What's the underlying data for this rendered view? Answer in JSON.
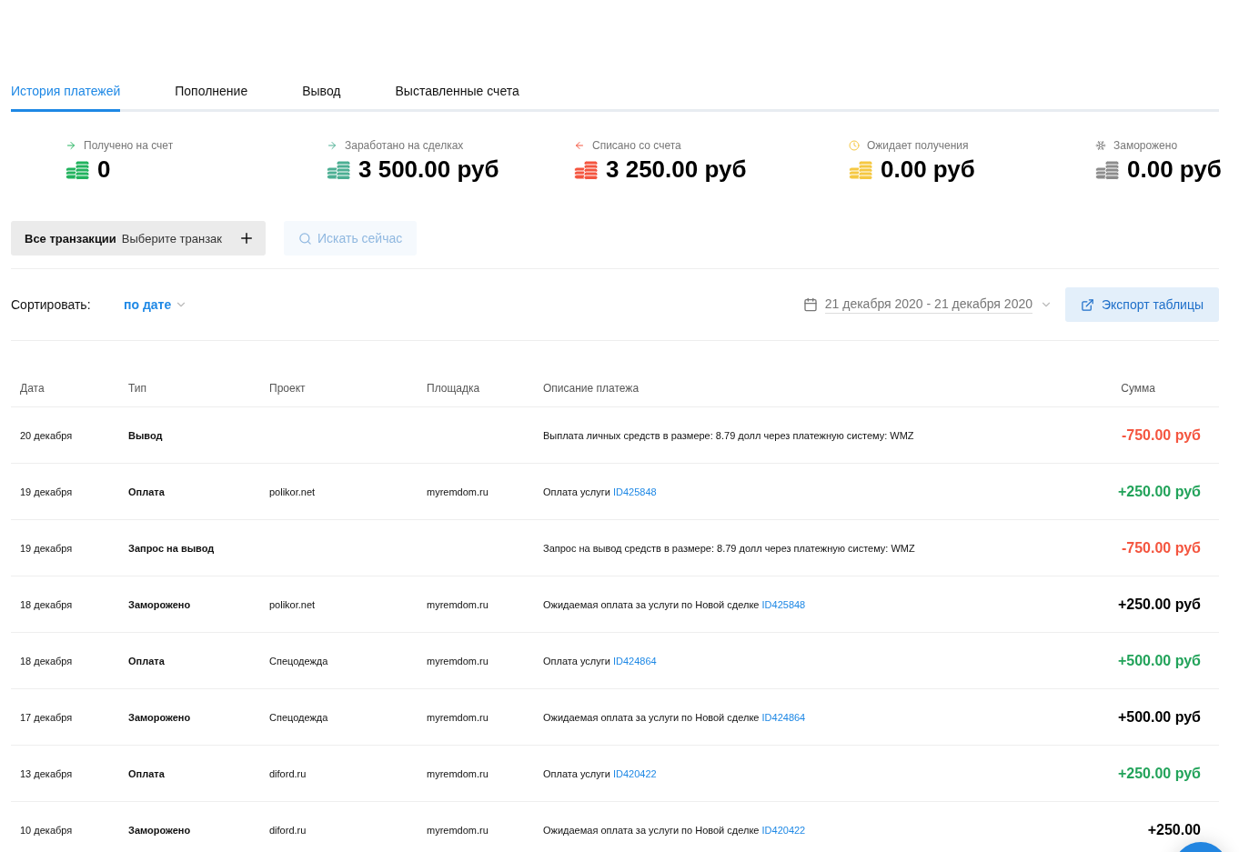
{
  "tabs": [
    {
      "label": "История платежей",
      "selected": true
    },
    {
      "label": "Пополнение",
      "selected": false
    },
    {
      "label": "Вывод",
      "selected": false
    },
    {
      "label": "Выставленные счета",
      "selected": false
    }
  ],
  "stats": [
    {
      "kind": "in",
      "label": "Получено на счет",
      "value": "0",
      "color": "#22b35e"
    },
    {
      "kind": "in",
      "label": "Заработано на сделках",
      "value": "3 500.00 руб",
      "color": "#4caf93"
    },
    {
      "kind": "out",
      "label": "Списано со счета",
      "value": "3 250.00 руб",
      "color": "#f4553f"
    },
    {
      "kind": "pending",
      "label": "Ожидает получения",
      "value": "0.00 руб",
      "color": "#f5c842"
    },
    {
      "kind": "frozen",
      "label": "Заморожено",
      "value": "0.00 руб",
      "color": "#8c8c8c"
    }
  ],
  "filter": {
    "label": "Все транзакции",
    "placeholder": "Выберите транзак"
  },
  "search": {
    "label": "Искать сейчас"
  },
  "sort": {
    "label": "Сортировать:",
    "value": "по дате",
    "date_range": "21 декабря 2020 - 21 декабря 2020",
    "export": "Экспорт таблицы"
  },
  "table": {
    "columns": [
      "Дата",
      "Тип",
      "Проект",
      "Площадка",
      "Описание платежа",
      "Сумма"
    ],
    "rows": [
      {
        "date": "20 декабря",
        "type": "Вывод",
        "project": "",
        "site": "",
        "description": "Выплата личных средств в размере: 8.79 долл через платежную систему: WMZ",
        "link": "",
        "amount": "-750.00 руб",
        "kind": "debit"
      },
      {
        "date": "19 декабря",
        "type": "Оплата",
        "project": "polikor.net",
        "site": "myremdom.ru",
        "description": "Оплата услуги",
        "link": "ID425848",
        "amount": "+250.00 руб",
        "kind": "credit"
      },
      {
        "date": "19 декабря",
        "type": "Запрос на вывод",
        "project": "",
        "site": "",
        "description": "Запрос на вывод средств в размере: 8.79 долл через платежную систему: WMZ",
        "link": "",
        "amount": "-750.00 руб",
        "kind": "debit"
      },
      {
        "date": "18 декабря",
        "type": "Заморожено",
        "project": "polikor.net",
        "site": "myremdom.ru",
        "description": "Ожидаемая оплата за услуги по Новой сделке",
        "link": "ID425848",
        "amount": "+250.00 руб",
        "kind": "frozen"
      },
      {
        "date": "18 декабря",
        "type": "Оплата",
        "project": "Спецодежда",
        "site": "myremdom.ru",
        "description": "Оплата услуги",
        "link": "ID424864",
        "amount": "+500.00 руб",
        "kind": "credit"
      },
      {
        "date": "17 декабря",
        "type": "Заморожено",
        "project": "Спецодежда",
        "site": "myremdom.ru",
        "description": "Ожидаемая оплата за услуги по Новой сделке",
        "link": "ID424864",
        "amount": "+500.00 руб",
        "kind": "frozen"
      },
      {
        "date": "13 декабря",
        "type": "Оплата",
        "project": "diford.ru",
        "site": "myremdom.ru",
        "description": "Оплата услуги",
        "link": "ID420422",
        "amount": "+250.00 руб",
        "kind": "credit"
      },
      {
        "date": "10 декабря",
        "type": "Заморожено",
        "project": "diford.ru",
        "site": "myremdom.ru",
        "description": "Ожидаемая оплата за услуги по Новой сделке",
        "link": "ID420422",
        "amount": "+250.00",
        "kind": "frozen"
      }
    ]
  }
}
